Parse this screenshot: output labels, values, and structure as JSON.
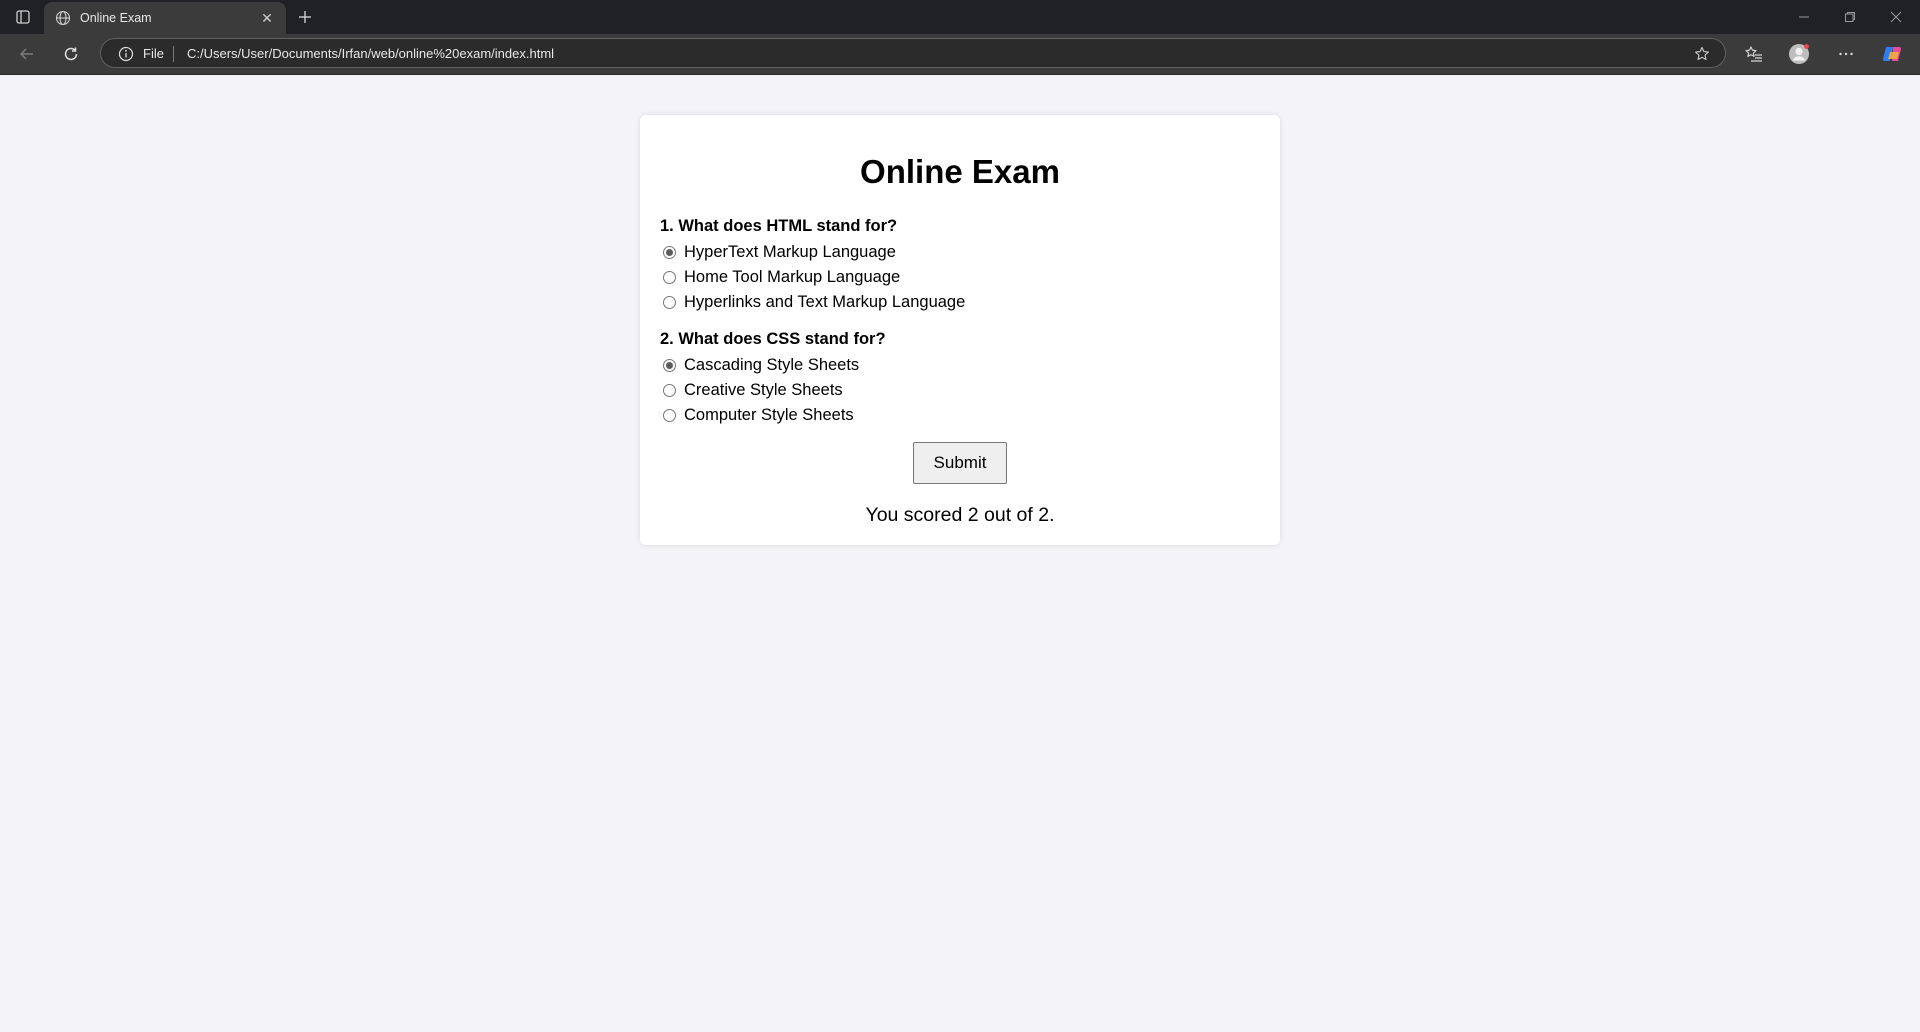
{
  "browser": {
    "tab_title": "Online Exam",
    "url_scheme": "File",
    "url": "C:/Users/User/Documents/Irfan/web/online%20exam/index.html",
    "icons": [
      "tab-actions-icon",
      "globe-icon",
      "close-icon",
      "plus-icon",
      "minimize-icon",
      "restore-icon",
      "window-close-icon",
      "back-icon",
      "refresh-icon",
      "info-icon",
      "star-icon",
      "favorites-icon",
      "profile-icon",
      "more-icon",
      "copilot-icon"
    ]
  },
  "exam": {
    "title": "Online Exam",
    "questions": [
      {
        "text": "1. What does HTML stand for?",
        "options": [
          {
            "label": "HyperText Markup Language",
            "checked": true
          },
          {
            "label": "Home Tool Markup Language",
            "checked": false
          },
          {
            "label": "Hyperlinks and Text Markup Language",
            "checked": false
          }
        ]
      },
      {
        "text": "2. What does CSS stand for?",
        "options": [
          {
            "label": "Cascading Style Sheets",
            "checked": true
          },
          {
            "label": "Creative Style Sheets",
            "checked": false
          },
          {
            "label": "Computer Style Sheets",
            "checked": false
          }
        ]
      }
    ],
    "submit_label": "Submit",
    "result": "You scored 2 out of 2."
  }
}
